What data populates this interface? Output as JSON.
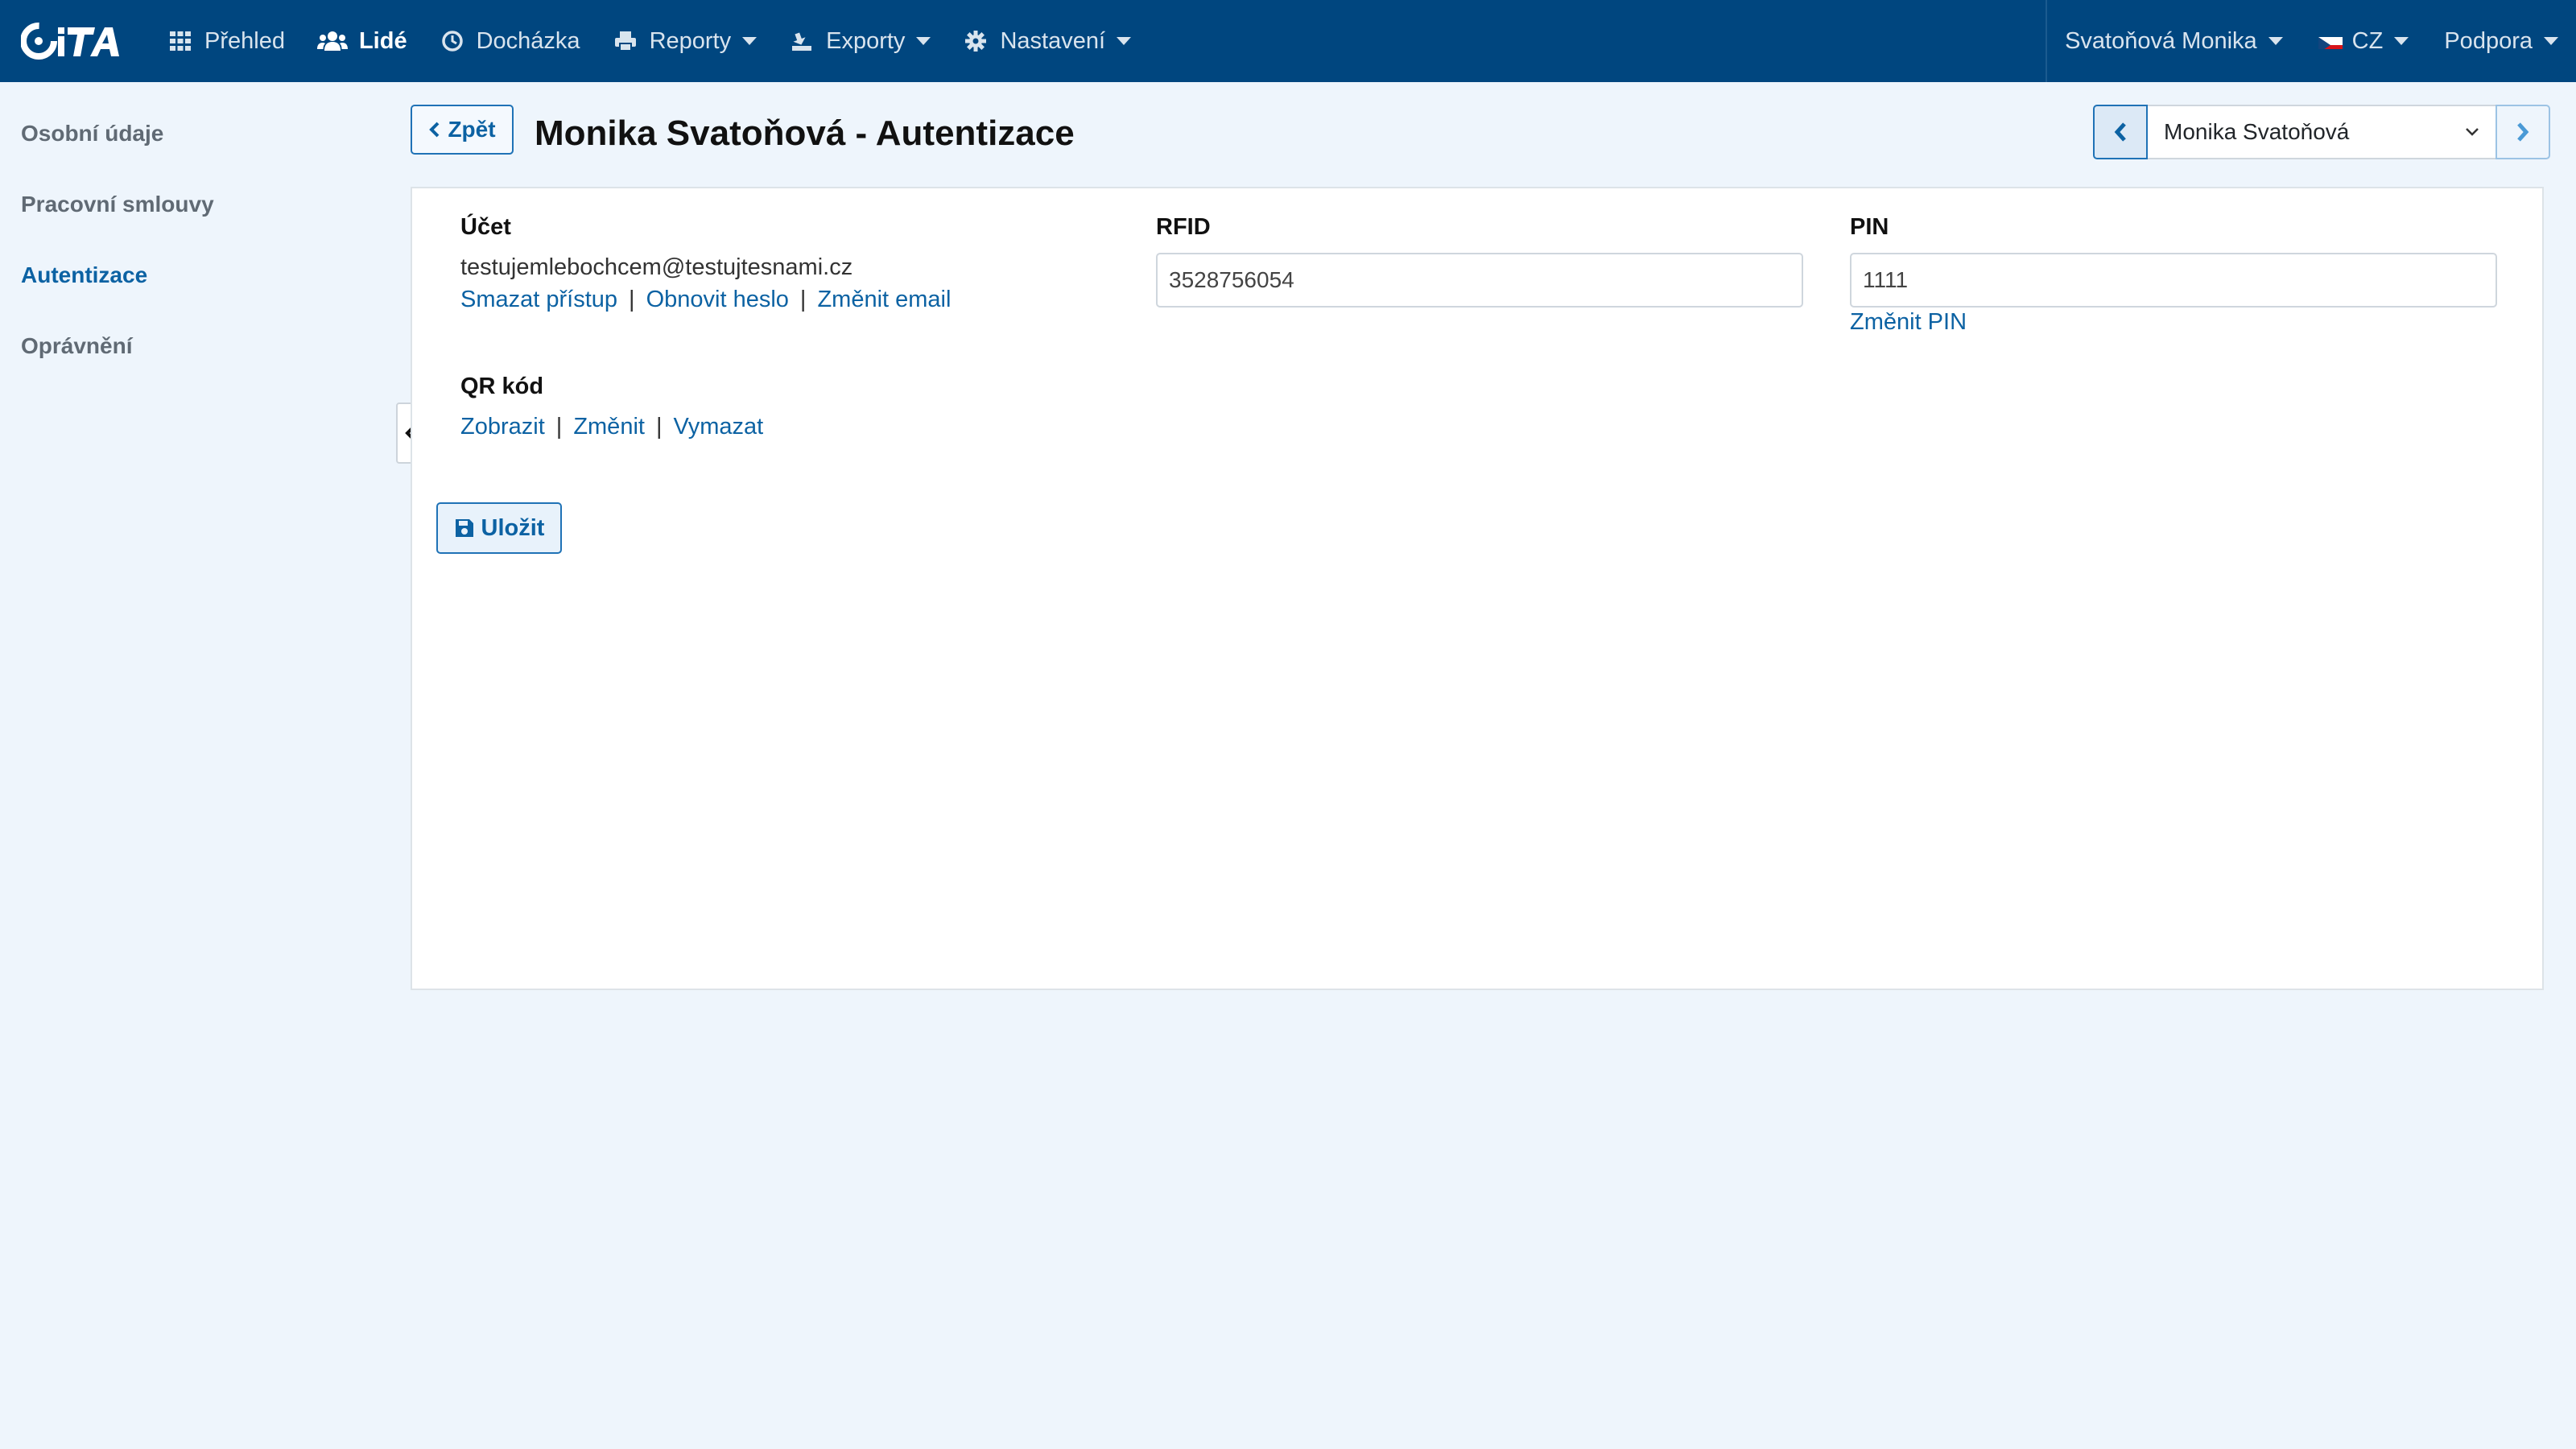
{
  "brand": {
    "logo_text": "CiTA"
  },
  "nav": {
    "items": [
      {
        "label": "Přehled",
        "icon": "grid-icon"
      },
      {
        "label": "Lidé",
        "icon": "users-icon",
        "active": true
      },
      {
        "label": "Docházka",
        "icon": "clock-icon"
      },
      {
        "label": "Reporty",
        "icon": "printer-icon",
        "dropdown": true
      },
      {
        "label": "Exporty",
        "icon": "export-icon",
        "dropdown": true
      },
      {
        "label": "Nastavení",
        "icon": "gear-icon",
        "dropdown": true
      }
    ],
    "user": "Svatoňová Monika",
    "language": "CZ",
    "support": "Podpora"
  },
  "sidebar": {
    "items": [
      {
        "label": "Osobní údaje"
      },
      {
        "label": "Pracovní smlouvy"
      },
      {
        "label": "Autentizace",
        "active": true
      },
      {
        "label": "Oprávnění"
      }
    ]
  },
  "header": {
    "back_label": "Zpět",
    "title": "Monika Svatoňová - Autentizace",
    "person_select_value": "Monika Svatoňová"
  },
  "account": {
    "label": "Účet",
    "email": "testujemlebochcem@testujtesnami.cz",
    "links": [
      "Smazat přístup",
      "Obnovit heslo",
      "Změnit email"
    ]
  },
  "rfid": {
    "label": "RFID",
    "value": "3528756054"
  },
  "pin": {
    "label": "PIN",
    "value": "1111",
    "change_link": "Změnit PIN"
  },
  "qr": {
    "label": "QR kód",
    "links": [
      "Zobrazit",
      "Změnit",
      "Vymazat"
    ]
  },
  "save_label": "Uložit",
  "colors": {
    "navbar": "#00467f",
    "accent": "#0c62a3",
    "page_bg": "#eef5fc"
  }
}
